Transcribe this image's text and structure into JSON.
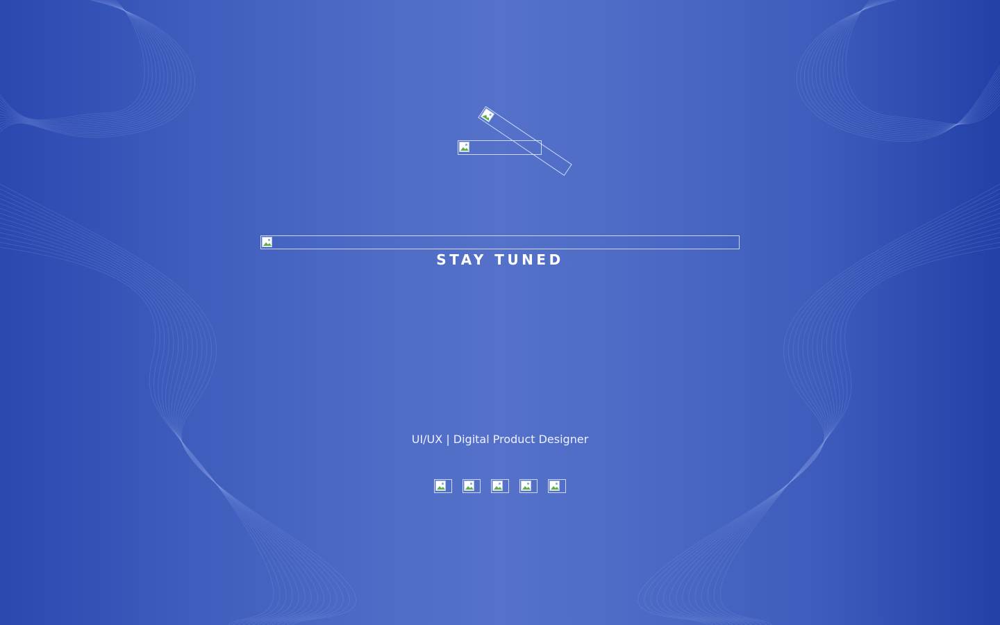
{
  "colors": {
    "background_center": "#5571c9",
    "background_edge": "#2241a8",
    "text": "#ffffff"
  },
  "hero": {
    "headline": "STAY TUNED",
    "tagline": "UI/UX | Digital Product Designer"
  },
  "images": {
    "logo_mark": "broken-image-icon",
    "logo_stroke": "broken-image-icon",
    "wordmark": "broken-image-icon"
  },
  "social": {
    "links": [
      {
        "icon": "broken-image-icon"
      },
      {
        "icon": "broken-image-icon"
      },
      {
        "icon": "broken-image-icon"
      },
      {
        "icon": "broken-image-icon"
      },
      {
        "icon": "broken-image-icon"
      }
    ]
  }
}
